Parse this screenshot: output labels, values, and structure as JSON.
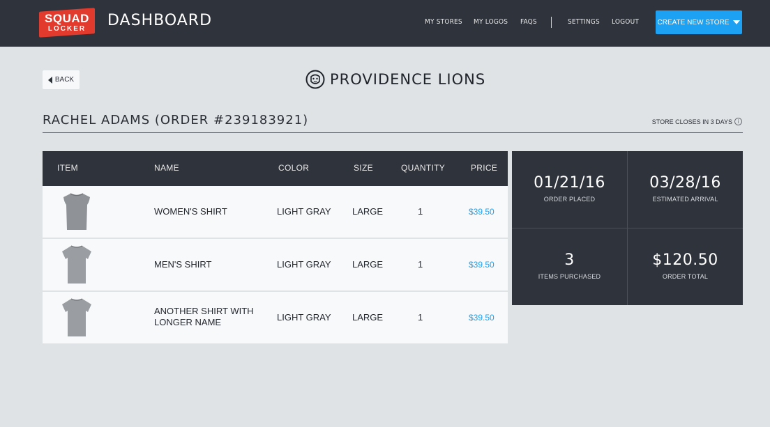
{
  "header": {
    "logo_line1": "SQUAD",
    "logo_line2": "LOCKER",
    "title": "DASHBOARD",
    "nav": [
      "MY STORES",
      "MY LOGOS",
      "FAQS",
      "SETTINGS",
      "LOGOUT"
    ],
    "create_label": "CREATE NEW STORE"
  },
  "back_label": "BACK",
  "store_name": "PROVIDENCE LIONS",
  "order_title": "RACHEL ADAMS (ORDER #239183921)",
  "store_closes": "STORE CLOSES IN 3 DAYS",
  "table": {
    "headers": [
      "ITEM",
      "NAME",
      "COLOR",
      "SIZE",
      "QUANTITY",
      "PRICE"
    ],
    "rows": [
      {
        "name": "WOMEN'S SHIRT",
        "color": "LIGHT GRAY",
        "size": "LARGE",
        "qty": "1",
        "price": "$39.50"
      },
      {
        "name": "MEN'S SHIRT",
        "color": "LIGHT GRAY",
        "size": "LARGE",
        "qty": "1",
        "price": "$39.50"
      },
      {
        "name": "ANOTHER SHIRT WITH LONGER NAME",
        "color": "LIGHT GRAY",
        "size": "LARGE",
        "qty": "1",
        "price": "$39.50"
      }
    ]
  },
  "stats": [
    {
      "value": "01/21/16",
      "label": "ORDER PLACED"
    },
    {
      "value": "03/28/16",
      "label": "ESTIMATED ARRIVAL"
    },
    {
      "value": "3",
      "label": "ITEMS PURCHASED"
    },
    {
      "value": "$120.50",
      "label": "ORDER TOTAL"
    }
  ],
  "colors": {
    "accent": "#1da1f2",
    "dark": "#2f333b",
    "brand": "#e23a2c",
    "background": "#dfe3e6"
  },
  "icons": [
    "caret-down-icon",
    "back-arrow-icon",
    "lion-logo-icon",
    "info-icon",
    "shirt-icon"
  ]
}
